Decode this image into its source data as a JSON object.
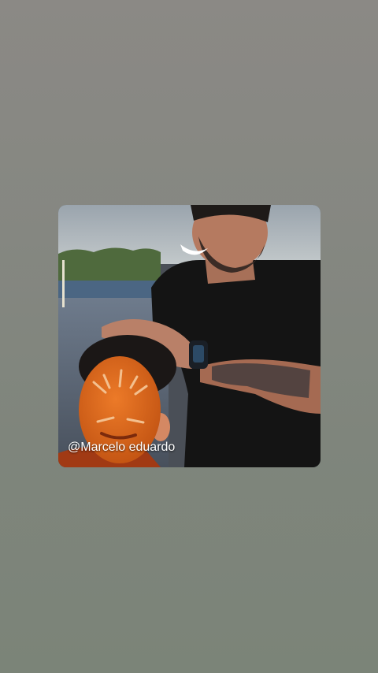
{
  "story": {
    "watermark": "@Marcelo eduardo"
  },
  "colors": {
    "background_top": "#8b8985",
    "background_bottom": "#7b8478",
    "face_paint": "#d9681e",
    "shirt": "#141414"
  }
}
